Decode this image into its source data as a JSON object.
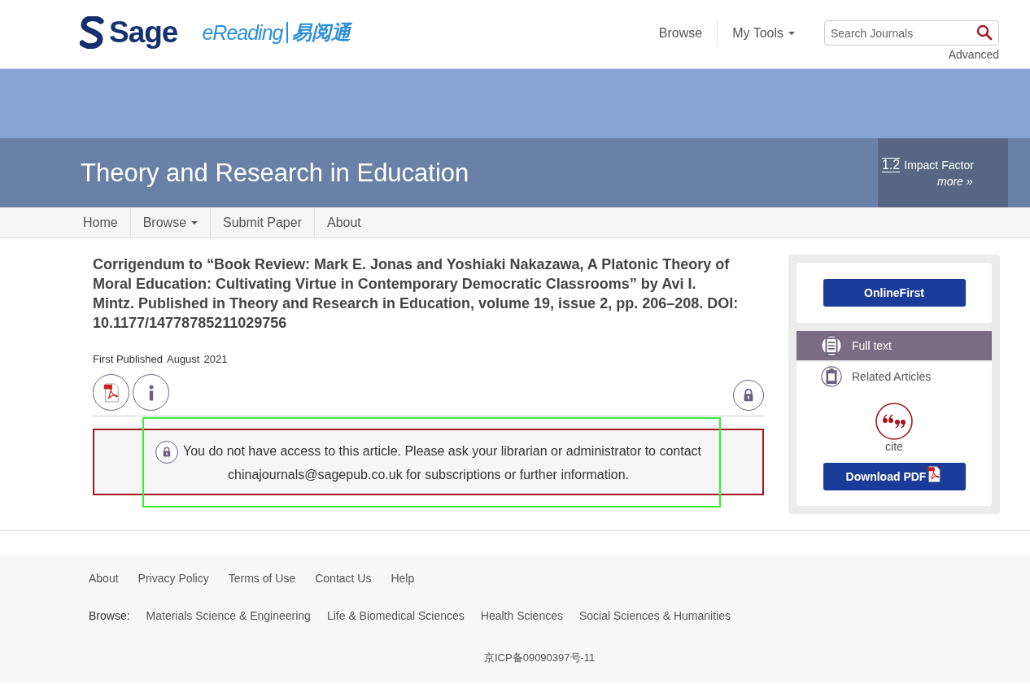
{
  "header": {
    "logo": "Sage",
    "partner_logo": {
      "latin": "eReading",
      "cjk": "易阅通"
    },
    "nav": [
      {
        "label": "Browse",
        "dropdown": false
      },
      {
        "label": "My Tools",
        "dropdown": true
      }
    ],
    "search": {
      "placeholder": "Search Journals"
    },
    "advanced_link": "Advanced"
  },
  "journal": {
    "title": "Theory and Research in Education",
    "impact_value": "1.2",
    "impact_label": "Impact Factor",
    "more_link": "more »"
  },
  "journal_nav": [
    {
      "label": "Home",
      "dropdown": false
    },
    {
      "label": "Browse",
      "dropdown": true
    },
    {
      "label": "Submit Paper",
      "dropdown": false
    },
    {
      "label": "About",
      "dropdown": false
    }
  ],
  "article": {
    "title": "Corrigendum to “Book Review: Mark E. Jonas and Yoshiaki Nakazawa, A Platonic Theory of Moral Education: Cultivating Virtue in Contemporary Democratic Classrooms” by Avi I. Mintz. Published in Theory and Research in Education, volume 19, issue 2, pp. 206–208. DOI: 10.1177/14778785211029756",
    "published_label": "First Published",
    "published_month": "August",
    "published_year": "2021",
    "access_message": "You do not have access to this article. Please ask your librarian or administrator to contact chinajournals@sagepub.co.uk for subscriptions or further information.",
    "highlighted": true
  },
  "sidebar": {
    "status_button": "OnlineFirst",
    "tabs": [
      {
        "label": "Full text",
        "selected": true,
        "kind": "document"
      },
      {
        "label": "Related Articles",
        "selected": false,
        "kind": "clipboard"
      }
    ],
    "cite_label": "cite",
    "download_button": "Download PDF"
  },
  "footer": {
    "links": [
      "About",
      "Privacy Policy",
      "Terms of Use",
      "Contact Us",
      "Help"
    ],
    "browse_label": "Browse:",
    "browse_links": [
      "Materials Science & Engineering",
      "Life & Biomedical Sciences",
      "Health Sciences",
      "Social Sciences & Humanities"
    ],
    "icp": "京ICP备09090397号-11"
  }
}
